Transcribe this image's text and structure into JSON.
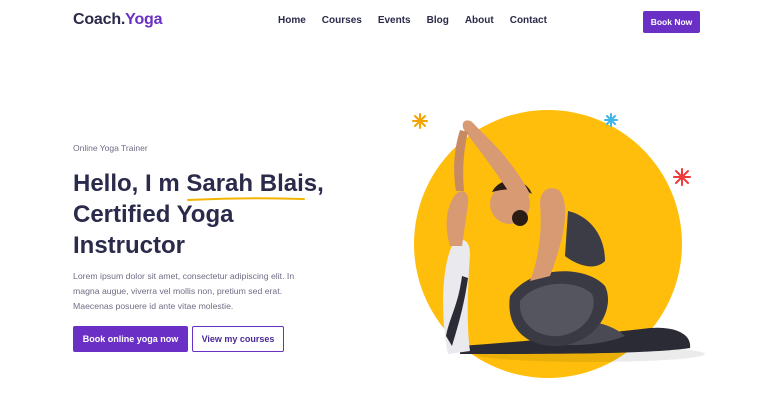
{
  "nav": {
    "logo_part1": "Coach.",
    "logo_part2": "Yoga",
    "items": [
      {
        "label": "Home"
      },
      {
        "label": "Courses"
      },
      {
        "label": "Events"
      },
      {
        "label": "Blog"
      },
      {
        "label": "About"
      },
      {
        "label": "Contact"
      }
    ],
    "book_label": "Book Now"
  },
  "hero": {
    "eyebrow": "Online Yoga Trainer",
    "headline_pre": "Hello, I m ",
    "headline_name": "Sarah Blais",
    "headline_comma": ",",
    "headline_line2": "Certified Yoga",
    "headline_line3": "Instructor",
    "body": "Lorem ipsum dolor sit amet, consectetur adipiscing elit. In magna augue, viverra vel mollis non, pretium sed erat. Maecenas posuere id ante vitae molestie.",
    "cta_primary": "Book online yoga now",
    "cta_secondary": "View my courses"
  },
  "colors": {
    "brand": "#6a2fc4",
    "text_dark": "#2a2a4a",
    "accent_yellow": "#ffbe0b",
    "underline": "#f2b400"
  }
}
